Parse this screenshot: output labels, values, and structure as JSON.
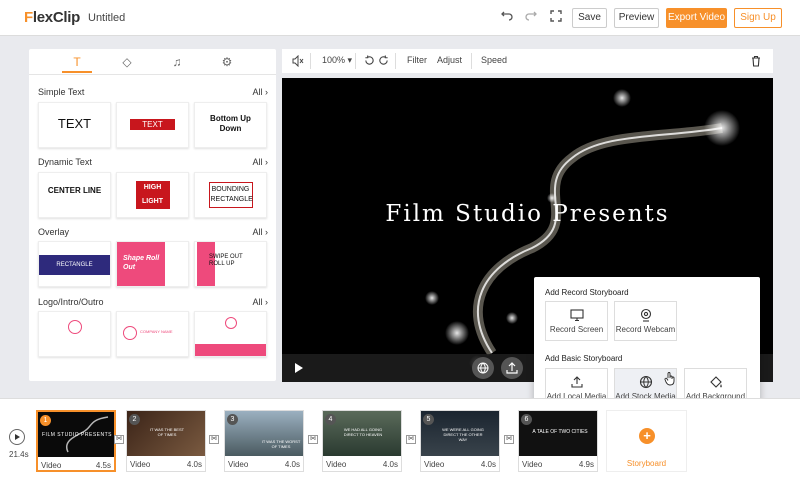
{
  "app": {
    "logo_prefix": "F",
    "logo_rest": "lexClip",
    "doc_title": "Untitled"
  },
  "topbar": {
    "undo_icon": "undo-icon",
    "redo_icon": "redo-icon",
    "fit_icon": "fullscreen-icon",
    "save": "Save",
    "preview": "Preview",
    "export": "Export Video",
    "signup": "Sign Up"
  },
  "panel": {
    "tabs": [
      {
        "icon": "text-icon",
        "glyph": "T"
      },
      {
        "icon": "elements-icon",
        "glyph": "◇"
      },
      {
        "icon": "music-icon",
        "glyph": "♫"
      },
      {
        "icon": "settings-icon",
        "glyph": "⚙"
      }
    ],
    "all_label": "All",
    "sections": [
      {
        "title": "Simple Text",
        "tiles": [
          "TEXT",
          "TEXT",
          "Bottom Up Down"
        ]
      },
      {
        "title": "Dynamic Text",
        "tiles": [
          "CENTER LINE",
          "HIGH LIGHT",
          "BOUNDING RECTANGLE"
        ]
      },
      {
        "title": "Overlay",
        "tiles": [
          "RECTANGLE",
          "Shape Roll Out",
          "SWIPE OUT ROLL UP"
        ]
      },
      {
        "title": "Logo/Intro/Outro",
        "tiles": [
          "",
          "COMPANY NAME",
          ""
        ]
      }
    ]
  },
  "preview_toolbar": {
    "zoom": "100%",
    "filter": "Filter",
    "adjust": "Adjust",
    "speed": "Speed"
  },
  "video": {
    "title": "Film Studio Presents"
  },
  "popup": {
    "record_header": "Add Record Storyboard",
    "record_screen": "Record Screen",
    "record_webcam": "Record Webcam",
    "basic_header": "Add Basic Storyboard",
    "local_media": "Add Local Media",
    "stock_media": "Add Stock Media",
    "background": "Add Background"
  },
  "timeline": {
    "total": "21.4s",
    "add_label": "Storyboard",
    "clips": [
      {
        "n": "1",
        "label": "Video",
        "dur": "4.5s",
        "thumb": "FILM STUDIO PRESENTS"
      },
      {
        "n": "2",
        "label": "Video",
        "dur": "4.0s",
        "thumb": "IT WAS THE BEST OF TIMES"
      },
      {
        "n": "3",
        "label": "Video",
        "dur": "4.0s",
        "thumb": "IT WAS THE WORST OF TIMES"
      },
      {
        "n": "4",
        "label": "Video",
        "dur": "4.0s",
        "thumb": "WE HAD ALL GOING DIRECT TO HEAVEN"
      },
      {
        "n": "5",
        "label": "Video",
        "dur": "4.0s",
        "thumb": "WE WERE ALL GOING DIRECT THE OTHER WAY"
      },
      {
        "n": "6",
        "label": "Video",
        "dur": "4.9s",
        "thumb": "A TALE OF TWO CITIES"
      }
    ]
  },
  "colors": {
    "accent": "#f7902a",
    "overlay_blue": "#2e2a7c",
    "pink": "#ee4a7c",
    "red": "#c8161d"
  }
}
